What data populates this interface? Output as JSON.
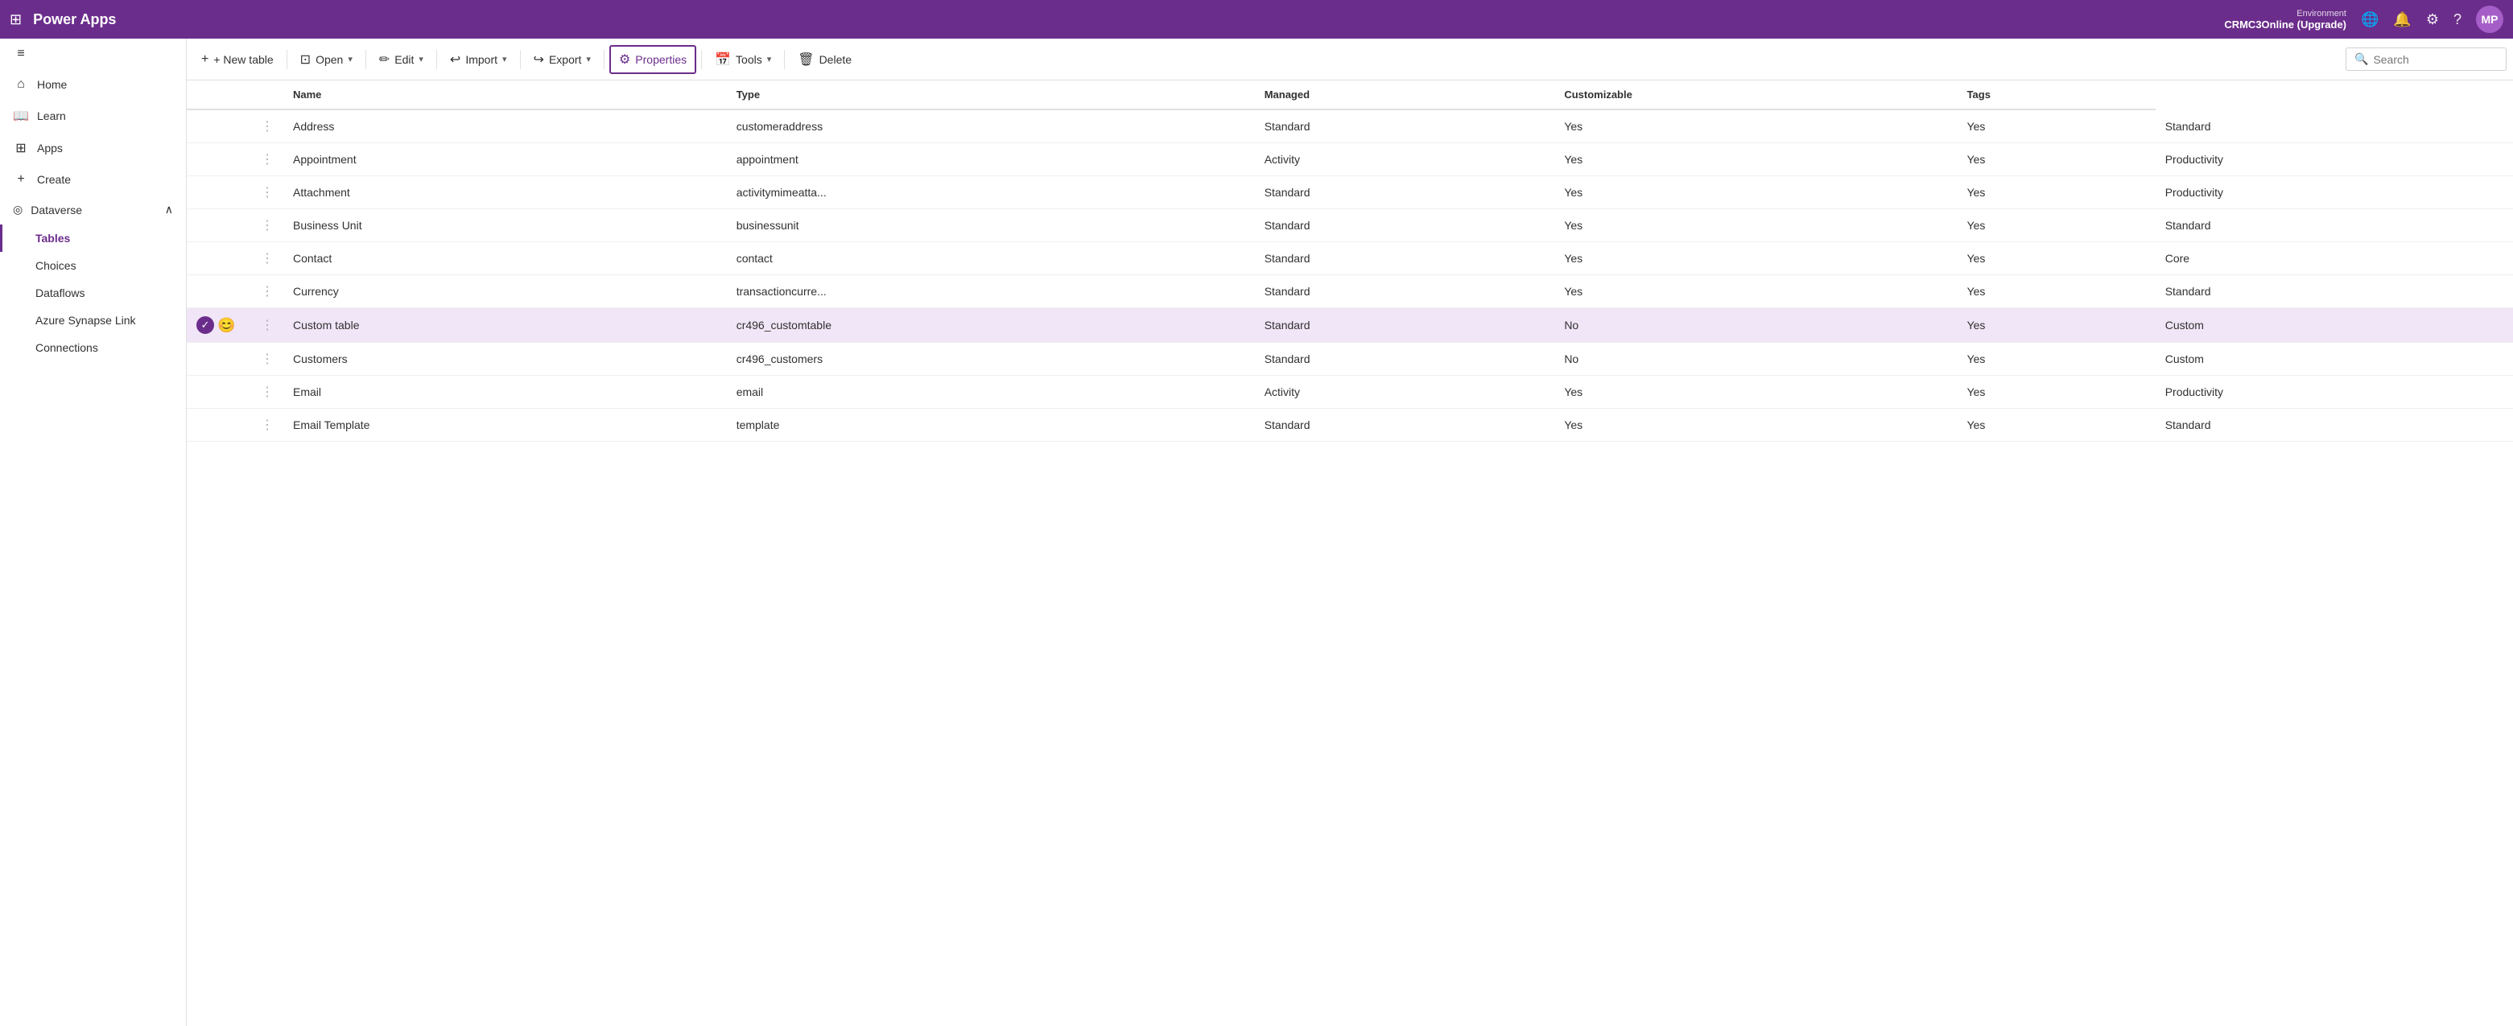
{
  "topbar": {
    "dots_icon": "⋮⋮⋮",
    "brand": "Power Apps",
    "env_label": "Environment",
    "env_name": "CRMC3Online (Upgrade)",
    "globe_icon": "🌐",
    "bell_icon": "🔔",
    "gear_icon": "⚙",
    "help_icon": "?",
    "avatar": "MP"
  },
  "toolbar": {
    "new_table": "+ New table",
    "open": "Open",
    "edit": "Edit",
    "import": "Import",
    "export": "Export",
    "properties": "Properties",
    "tools": "Tools",
    "delete": "Delete",
    "search_placeholder": "Search"
  },
  "sidebar": {
    "collapse_icon": "≡",
    "items": [
      {
        "id": "home",
        "icon": "⌂",
        "label": "Home"
      },
      {
        "id": "learn",
        "icon": "📖",
        "label": "Learn"
      },
      {
        "id": "apps",
        "icon": "⊞",
        "label": "Apps"
      },
      {
        "id": "create",
        "icon": "+",
        "label": "Create"
      }
    ],
    "dataverse_label": "Dataverse",
    "dataverse_icon": "◎",
    "dataverse_chevron": "∧",
    "sub_items": [
      {
        "id": "tables",
        "label": "Tables",
        "active": true
      },
      {
        "id": "choices",
        "label": "Choices"
      },
      {
        "id": "dataflows",
        "label": "Dataflows"
      },
      {
        "id": "azure-synapse",
        "label": "Azure Synapse Link"
      },
      {
        "id": "connections",
        "label": "Connections"
      }
    ]
  },
  "table": {
    "columns": [
      "Name",
      "",
      "Name",
      "Type",
      "Managed",
      "Customizable",
      "Tags"
    ],
    "rows": [
      {
        "name": "Address",
        "dots": true,
        "logical_name": "customeraddress",
        "type": "Standard",
        "managed": "Yes",
        "customizable": "Yes",
        "tags": "Standard",
        "selected": false,
        "icons": []
      },
      {
        "name": "Appointment",
        "dots": true,
        "logical_name": "appointment",
        "type": "Activity",
        "managed": "Yes",
        "customizable": "Yes",
        "tags": "Productivity",
        "selected": false,
        "icons": []
      },
      {
        "name": "Attachment",
        "dots": true,
        "logical_name": "activitymimeatta...",
        "type": "Standard",
        "managed": "Yes",
        "customizable": "Yes",
        "tags": "Productivity",
        "selected": false,
        "icons": []
      },
      {
        "name": "Business Unit",
        "dots": true,
        "logical_name": "businessunit",
        "type": "Standard",
        "managed": "Yes",
        "customizable": "Yes",
        "tags": "Standard",
        "selected": false,
        "icons": []
      },
      {
        "name": "Contact",
        "dots": true,
        "logical_name": "contact",
        "type": "Standard",
        "managed": "Yes",
        "customizable": "Yes",
        "tags": "Core",
        "selected": false,
        "icons": []
      },
      {
        "name": "Currency",
        "dots": true,
        "logical_name": "transactioncurre...",
        "type": "Standard",
        "managed": "Yes",
        "customizable": "Yes",
        "tags": "Standard",
        "selected": false,
        "icons": []
      },
      {
        "name": "Custom table",
        "dots": true,
        "logical_name": "cr496_customtable",
        "type": "Standard",
        "managed": "No",
        "customizable": "Yes",
        "tags": "Custom",
        "selected": true,
        "icons": [
          "check",
          "emoji"
        ]
      },
      {
        "name": "Customers",
        "dots": true,
        "logical_name": "cr496_customers",
        "type": "Standard",
        "managed": "No",
        "customizable": "Yes",
        "tags": "Custom",
        "selected": false,
        "icons": []
      },
      {
        "name": "Email",
        "dots": true,
        "logical_name": "email",
        "type": "Activity",
        "managed": "Yes",
        "customizable": "Yes",
        "tags": "Productivity",
        "selected": false,
        "icons": []
      },
      {
        "name": "Email Template",
        "dots": true,
        "logical_name": "template",
        "type": "Standard",
        "managed": "Yes",
        "customizable": "Yes",
        "tags": "Standard",
        "selected": false,
        "icons": []
      }
    ]
  }
}
